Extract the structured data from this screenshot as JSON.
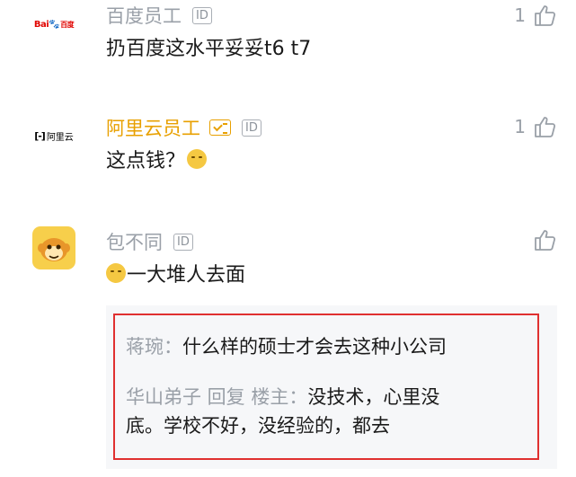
{
  "comments": [
    {
      "author": "百度员工",
      "tag": "ID",
      "content": "扔百度这水平妥妥t6 t7",
      "likes": "1",
      "avatar": {
        "logo_text": "Bai",
        "logo_paw": "🐾",
        "logo_cn": "百度"
      }
    },
    {
      "author": "阿里云员工",
      "tag": "ID",
      "content": "这点钱？",
      "likes": "1",
      "avatar": {
        "logo_bracket": "[-]",
        "logo_cn": "阿里云"
      }
    },
    {
      "author": "包不同",
      "tag": "ID",
      "content": "一大堆人去面",
      "likes": ""
    }
  ],
  "replies": [
    {
      "name": "蒋琬：",
      "text": "什么样的硕士才会去这种小公司"
    },
    {
      "name": "华山弟子 回复 楼主：",
      "text": "没技术，心里没",
      "text2": "底。学校不好，没经验的，都去"
    }
  ],
  "colors": {
    "accent_gold": "#e8a000",
    "muted": "#9aa0a8",
    "highlight_red": "#e03030"
  }
}
